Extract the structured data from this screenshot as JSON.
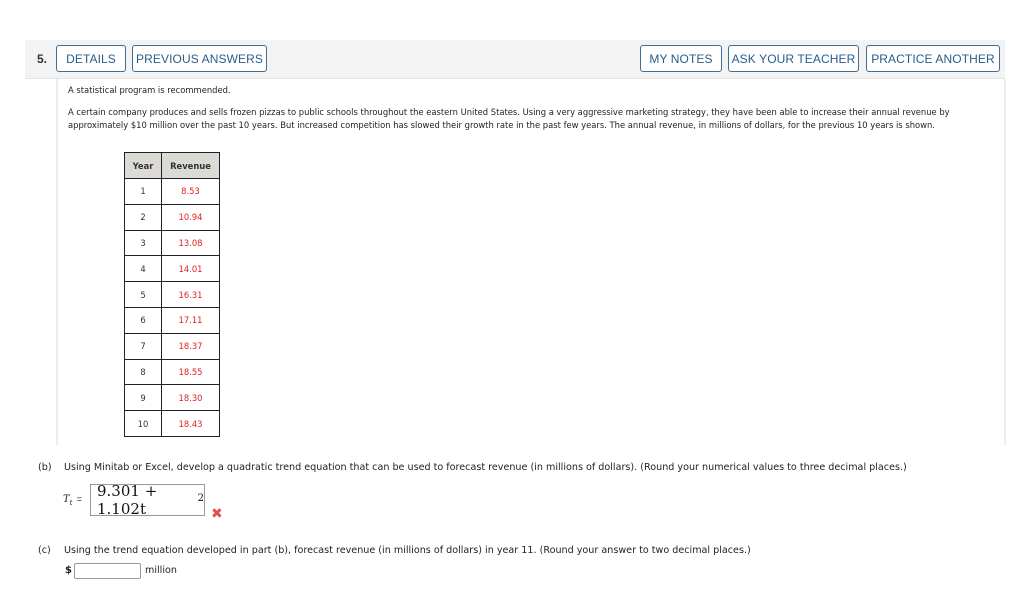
{
  "question": {
    "number": "5.",
    "buttons": {
      "details": "DETAILS",
      "previous_answers": "PREVIOUS ANSWERS",
      "my_notes": "MY NOTES",
      "ask_teacher": "ASK YOUR TEACHER",
      "practice_another": "PRACTICE ANOTHER"
    },
    "note": "A statistical program is recommended.",
    "body": "A certain company produces and sells frozen pizzas to public schools throughout the eastern United States. Using a very aggressive marketing strategy, they have been able to increase their annual revenue by approximately $10 million over the past 10 years. But increased competition has slowed their growth rate in the past few years. The annual revenue, in millions of dollars, for the previous 10 years is shown."
  },
  "table": {
    "headers": [
      "Year",
      "Revenue"
    ],
    "rows": [
      {
        "year": "1",
        "revenue": "8.53"
      },
      {
        "year": "2",
        "revenue": "10.94"
      },
      {
        "year": "3",
        "revenue": "13.08"
      },
      {
        "year": "4",
        "revenue": "14.01"
      },
      {
        "year": "5",
        "revenue": "16.31"
      },
      {
        "year": "6",
        "revenue": "17.11"
      },
      {
        "year": "7",
        "revenue": "18.37"
      },
      {
        "year": "8",
        "revenue": "18.55"
      },
      {
        "year": "9",
        "revenue": "18.30"
      },
      {
        "year": "10",
        "revenue": "18.43"
      }
    ]
  },
  "part_b": {
    "label": "(b)",
    "text": "Using Minitab or Excel, develop a quadratic trend equation that can be used to forecast revenue (in millions of dollars). (Round your numerical values to three decimal places.)",
    "lhs_var": "T",
    "lhs_sub": "t",
    "equals": "=",
    "answer_main": "9.301 + 1.102t",
    "answer_exp": "2",
    "status": "incorrect",
    "status_icon": "✖",
    "status_color": "#e05050"
  },
  "part_c": {
    "label": "(c)",
    "text": "Using the trend equation developed in part (b), forecast revenue (in millions of dollars) in year 11. (Round your answer to two decimal places.)",
    "currency": "$",
    "input_value": "",
    "unit": "million"
  },
  "colors": {
    "button_border": "#3d6e98",
    "button_text": "#2a5c88",
    "revenue_text": "#e02020"
  }
}
